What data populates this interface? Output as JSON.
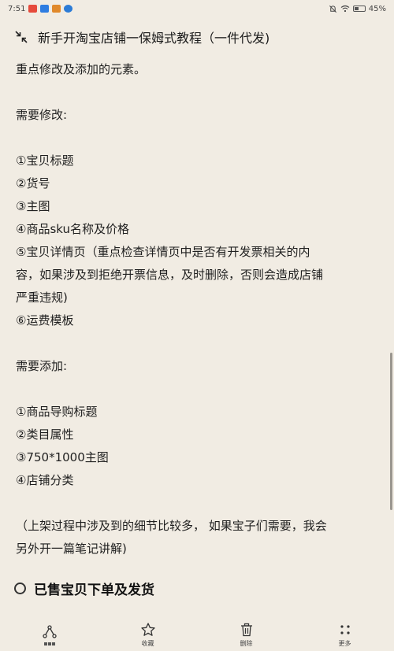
{
  "status": {
    "time": "7:51",
    "battery": "45%",
    "battery_level": 0.45,
    "app_badge_colors": [
      "#e64a3b",
      "#2f7de1",
      "#e0892b",
      "#2b7bd6"
    ]
  },
  "header": {
    "title": "新手开淘宝店铺一保姆式教程（一件代发)"
  },
  "content": {
    "lines": [
      "重点修改及添加的元素。",
      "",
      "需要修改:",
      "",
      "①宝贝标题",
      "②货号",
      "③主图",
      "④商品sku名称及价格",
      "⑤宝贝详情页（重点检查详情页中是否有开发票相关的内",
      "容，如果涉及到拒绝开票信息，及时删除，否则会造成店铺",
      "严重违规)",
      "⑥运费模板",
      "",
      "需要添加:",
      "",
      "①商品导购标题",
      "②类目属性",
      "③750*1000主图",
      "④店铺分类",
      "",
      "（上架过程中涉及到的细节比较多， 如果宝子们需要，我会",
      "另外开一篇笔记讲解)"
    ],
    "todo_heading": "已售宝贝下单及发货"
  },
  "toolbar": {
    "collect": "收藏",
    "delete": "删除",
    "more": "更多"
  }
}
